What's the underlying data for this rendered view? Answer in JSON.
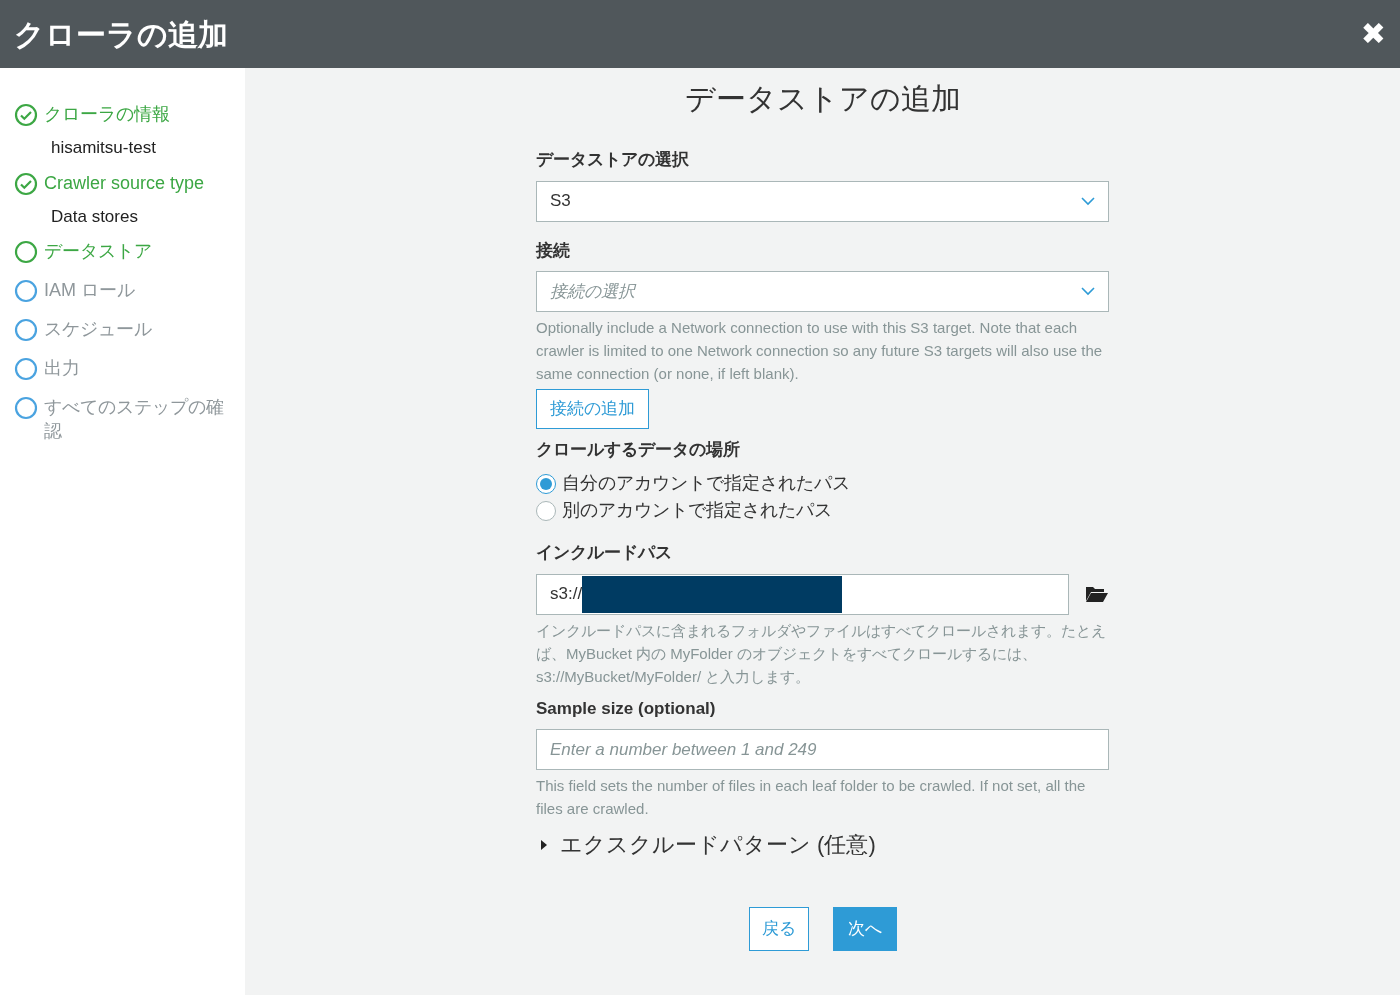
{
  "window": {
    "title": "クローラの追加",
    "close_glyph": "✖"
  },
  "steps": [
    {
      "label": "クローラの情報",
      "checked": true,
      "disabled": false,
      "detail": "hisamitsu-test"
    },
    {
      "label": "Crawler source type",
      "checked": true,
      "disabled": false,
      "detail": "Data stores"
    },
    {
      "label": "データストア",
      "checked": false,
      "disabled": false
    },
    {
      "label": "IAM ロール",
      "checked": false,
      "disabled": true
    },
    {
      "label": "スケジュール",
      "checked": false,
      "disabled": true
    },
    {
      "label": "出力",
      "checked": false,
      "disabled": true
    },
    {
      "label": "すべてのステップの確認",
      "checked": false,
      "disabled": true
    }
  ],
  "form": {
    "heading": "データストアの追加",
    "datastore": {
      "label": "データストアの選択",
      "value": "S3"
    },
    "connection": {
      "label": "接続",
      "placeholder": "接続の選択",
      "help": "Optionally include a Network connection to use with this S3 target. Note that each crawler is limited to one Network connection so any future S3 targets will also use the same connection (or none, if left blank).",
      "add_button": "接続の追加"
    },
    "location": {
      "label": "クロールするデータの場所",
      "options": [
        {
          "label": "自分のアカウントで指定されたパス",
          "selected": true
        },
        {
          "label": "別のアカウントで指定されたパス",
          "selected": false
        }
      ]
    },
    "include_path": {
      "label": "インクルードパス",
      "value": "s3://",
      "redacted": true,
      "help": "インクルードパスに含まれるフォルダやファイルはすべてクロールされます。たとえば、MyBucket 内の MyFolder のオブジェクトをすべてクロールするには、s3://MyBucket/MyFolder/ と入力します。"
    },
    "sample_size": {
      "label": "Sample size (optional)",
      "placeholder": "Enter a number between 1 and 249",
      "help": "This field sets the number of files in each leaf folder to be crawled. If not set, all the files are crawled."
    },
    "exclude": {
      "label": "エクスクルードパターン (任意)",
      "expanded": false
    }
  },
  "buttons": {
    "back": "戻る",
    "next": "次へ"
  }
}
